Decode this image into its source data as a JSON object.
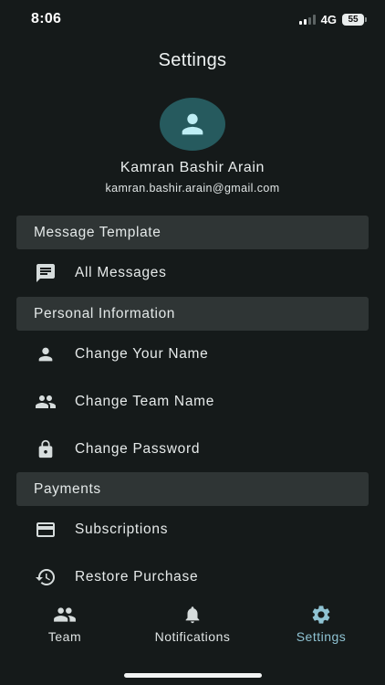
{
  "status": {
    "time": "8:06",
    "network": "4G",
    "battery": "55"
  },
  "header": {
    "title": "Settings"
  },
  "profile": {
    "name": "Kamran Bashir Arain",
    "email": "kamran.bashir.arain@gmail.com",
    "avatar_icon": "person-icon"
  },
  "sections": [
    {
      "title": "Message Template",
      "items": [
        {
          "label": "All Messages",
          "icon": "message-icon"
        }
      ]
    },
    {
      "title": "Personal Information",
      "items": [
        {
          "label": "Change Your Name",
          "icon": "person-icon"
        },
        {
          "label": "Change Team Name",
          "icon": "group-icon"
        },
        {
          "label": "Change Password",
          "icon": "lock-icon"
        }
      ]
    },
    {
      "title": "Payments",
      "items": [
        {
          "label": "Subscriptions",
          "icon": "credit-card-icon"
        },
        {
          "label": "Restore Purchase",
          "icon": "history-icon"
        }
      ]
    }
  ],
  "tabs": [
    {
      "label": "Team",
      "icon": "group-icon",
      "active": false
    },
    {
      "label": "Notifications",
      "icon": "bell-icon",
      "active": false
    },
    {
      "label": "Settings",
      "icon": "gear-icon",
      "active": true
    }
  ],
  "colors": {
    "background": "#151a1a",
    "section_header": "#2f3535",
    "avatar": "#265a5e",
    "active_tab": "#8fc3d3"
  }
}
